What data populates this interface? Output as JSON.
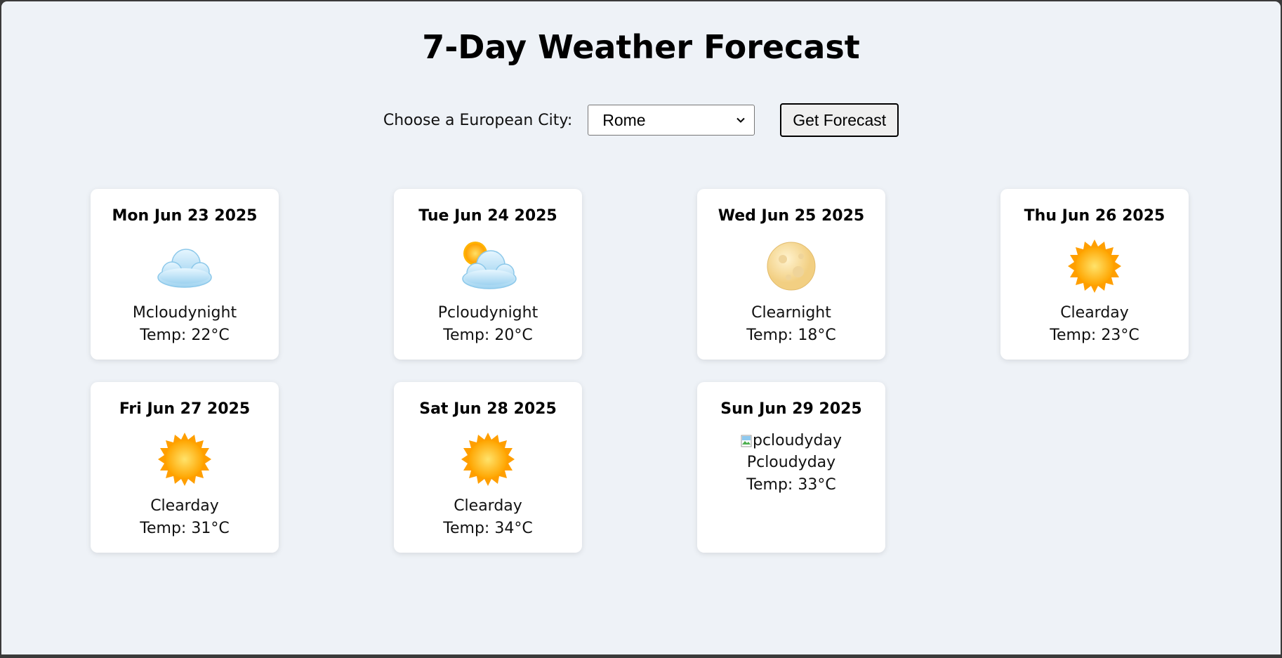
{
  "page": {
    "title": "7-Day Weather Forecast"
  },
  "controls": {
    "city_label": "Choose a European City:",
    "city_selected": "Rome",
    "button_label": "Get Forecast"
  },
  "colors": {
    "background": "#eef2f7",
    "card": "#ffffff",
    "sun": "#ffb300",
    "cloud": "#bfe3f7",
    "moon": "#fbe3a6"
  },
  "forecast": [
    {
      "date": "Mon Jun 23 2025",
      "icon": "cloud-icon",
      "condition": "Mcloudynight",
      "temp": "Temp: 22°C"
    },
    {
      "date": "Tue Jun 24 2025",
      "icon": "sun-behind-cloud-icon",
      "condition": "Pcloudynight",
      "temp": "Temp: 20°C"
    },
    {
      "date": "Wed Jun 25 2025",
      "icon": "full-moon-icon",
      "condition": "Clearnight",
      "temp": "Temp: 18°C"
    },
    {
      "date": "Thu Jun 26 2025",
      "icon": "sun-icon",
      "condition": "Clearday",
      "temp": "Temp: 23°C"
    },
    {
      "date": "Fri Jun 27 2025",
      "icon": "sun-icon",
      "condition": "Clearday",
      "temp": "Temp: 31°C"
    },
    {
      "date": "Sat Jun 28 2025",
      "icon": "sun-icon",
      "condition": "Clearday",
      "temp": "Temp: 34°C"
    },
    {
      "date": "Sun Jun 29 2025",
      "icon": "broken-image-icon",
      "icon_alt": "pcloudyday",
      "condition": "Pcloudyday",
      "temp": "Temp: 33°C"
    }
  ]
}
